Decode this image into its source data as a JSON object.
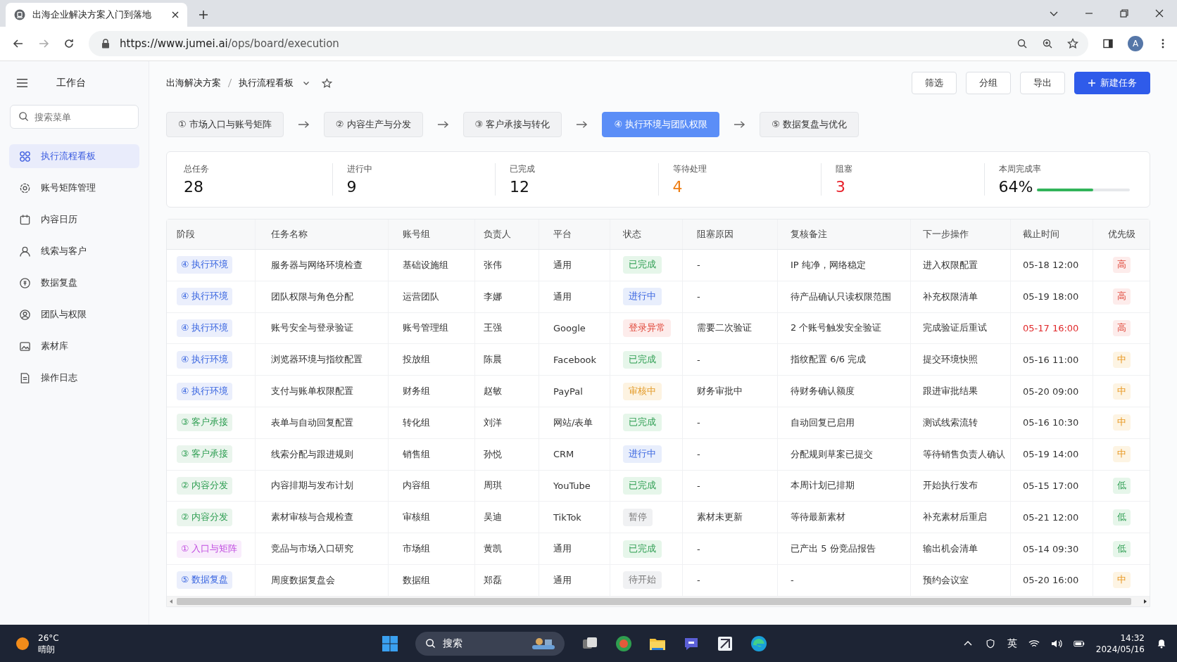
{
  "browser": {
    "tab_title": "出海企业解决方案入门到落地",
    "url_host": "https://www.jumei.ai",
    "url_path": "/ops/board/execution",
    "profile": "A"
  },
  "sidebar": {
    "title": "工作台",
    "search_placeholder": "搜索菜单",
    "items": [
      {
        "label": "执行流程看板",
        "selected": true
      },
      {
        "label": "账号矩阵管理",
        "selected": false
      },
      {
        "label": "内容日历",
        "selected": false
      },
      {
        "label": "线索与客户",
        "selected": false
      },
      {
        "label": "数据复盘",
        "selected": false
      },
      {
        "label": "团队与权限",
        "selected": false
      },
      {
        "label": "素材库",
        "selected": false
      },
      {
        "label": "操作日志",
        "selected": false
      }
    ]
  },
  "breadcrumb": [
    "出海解决方案",
    "执行流程看板"
  ],
  "actions": [
    {
      "label": "筛选",
      "kind": "plain"
    },
    {
      "label": "分组",
      "kind": "plain"
    },
    {
      "label": "导出",
      "kind": "plain"
    },
    {
      "label": "新建任务",
      "kind": "primary"
    }
  ],
  "steps": [
    {
      "number": "①",
      "label": "市场入口与账号矩阵",
      "selected": false
    },
    {
      "number": "②",
      "label": "内容生产与分发",
      "selected": false
    },
    {
      "number": "③",
      "label": "客户承接与转化",
      "selected": false
    },
    {
      "number": "④",
      "label": "执行环境与团队权限",
      "selected": true
    },
    {
      "number": "⑤",
      "label": "数据复盘与优化",
      "selected": false
    }
  ],
  "stats": [
    {
      "label": "总任务",
      "value": "28",
      "kind": "plain"
    },
    {
      "label": "进行中",
      "value": "9",
      "kind": "plain"
    },
    {
      "label": "已完成",
      "value": "12",
      "kind": "plain"
    },
    {
      "label": "等待处理",
      "value": "4",
      "kind": "warning"
    },
    {
      "label": "阻塞",
      "value": "3",
      "kind": "danger"
    },
    {
      "label": "本周完成率",
      "value": "64%",
      "kind": "progress",
      "level": 0.6
    }
  ],
  "table": {
    "columns": [
      "阶段",
      "任务名称",
      "账号组",
      "负责人",
      "平台",
      "状态",
      "阻塞原因",
      "复核备注",
      "下一步操作",
      "截止时间",
      "优先级"
    ],
    "rows": [
      {
        "stage": {
          "label": "④ 执行环境",
          "color": "#3a66e0"
        },
        "task": "服务器与网络环境检查",
        "group": "基础设施组",
        "owner": "张伟",
        "platform": "通用",
        "status": {
          "label": "已完成",
          "kind": "done"
        },
        "reason": "-",
        "note": "IP 纯净，网络稳定",
        "next": "进入权限配置",
        "deadline": "05-18 12:00",
        "overdue": false,
        "priority": {
          "label": "高",
          "kind": "high"
        }
      },
      {
        "stage": {
          "label": "④ 执行环境",
          "color": "#3a66e0"
        },
        "task": "团队权限与角色分配",
        "group": "运营团队",
        "owner": "李娜",
        "platform": "通用",
        "status": {
          "label": "进行中",
          "kind": "progress"
        },
        "reason": "-",
        "note": "待产品确认只读权限范围",
        "next": "补充权限清单",
        "deadline": "05-19 18:00",
        "overdue": false,
        "priority": {
          "label": "高",
          "kind": "high"
        }
      },
      {
        "stage": {
          "label": "④ 执行环境",
          "color": "#3a66e0"
        },
        "task": "账号安全与登录验证",
        "group": "账号管理组",
        "owner": "王强",
        "platform": "Google",
        "status": {
          "label": "登录异常",
          "kind": "error"
        },
        "reason": "需要二次验证",
        "note": "2 个账号触发安全验证",
        "next": "完成验证后重试",
        "deadline": "05-17 16:00",
        "overdue": true,
        "priority": {
          "label": "高",
          "kind": "high"
        }
      },
      {
        "stage": {
          "label": "④ 执行环境",
          "color": "#3a66e0"
        },
        "task": "浏览器环境与指纹配置",
        "group": "投放组",
        "owner": "陈晨",
        "platform": "Facebook",
        "status": {
          "label": "已完成",
          "kind": "done"
        },
        "reason": "-",
        "note": "指纹配置 6/6 完成",
        "next": "提交环境快照",
        "deadline": "05-16 11:00",
        "overdue": false,
        "priority": {
          "label": "中",
          "kind": "mid"
        }
      },
      {
        "stage": {
          "label": "④ 执行环境",
          "color": "#3a66e0"
        },
        "task": "支付与账单权限配置",
        "group": "财务组",
        "owner": "赵敏",
        "platform": "PayPal",
        "status": {
          "label": "审核中",
          "kind": "review"
        },
        "reason": "财务审批中",
        "note": "待财务确认额度",
        "next": "跟进审批结果",
        "deadline": "05-20 09:00",
        "overdue": false,
        "priority": {
          "label": "中",
          "kind": "mid"
        }
      },
      {
        "stage": {
          "label": "③ 客户承接",
          "color": "#2e9e52"
        },
        "task": "表单与自动回复配置",
        "group": "转化组",
        "owner": "刘洋",
        "platform": "网站/表单",
        "status": {
          "label": "已完成",
          "kind": "done"
        },
        "reason": "-",
        "note": "自动回复已启用",
        "next": "测试线索流转",
        "deadline": "05-16 10:30",
        "overdue": false,
        "priority": {
          "label": "中",
          "kind": "mid"
        }
      },
      {
        "stage": {
          "label": "③ 客户承接",
          "color": "#2e9e52"
        },
        "task": "线索分配与跟进规则",
        "group": "销售组",
        "owner": "孙悦",
        "platform": "CRM",
        "status": {
          "label": "进行中",
          "kind": "progress"
        },
        "reason": "-",
        "note": "分配规则草案已提交",
        "next": "等待销售负责人确认",
        "deadline": "05-19 14:00",
        "overdue": false,
        "priority": {
          "label": "中",
          "kind": "mid"
        }
      },
      {
        "stage": {
          "label": "② 内容分发",
          "color": "#2e9e52"
        },
        "task": "内容排期与发布计划",
        "group": "内容组",
        "owner": "周琪",
        "platform": "YouTube",
        "status": {
          "label": "已完成",
          "kind": "done"
        },
        "reason": "-",
        "note": "本周计划已排期",
        "next": "开始执行发布",
        "deadline": "05-15 17:00",
        "overdue": false,
        "priority": {
          "label": "低",
          "kind": "low"
        }
      },
      {
        "stage": {
          "label": "② 内容分发",
          "color": "#2e9e52"
        },
        "task": "素材审核与合规检查",
        "group": "审核组",
        "owner": "吴迪",
        "platform": "TikTok",
        "status": {
          "label": "暂停",
          "kind": "paused"
        },
        "reason": "素材未更新",
        "note": "等待最新素材",
        "next": "补充素材后重启",
        "deadline": "05-21 12:00",
        "overdue": false,
        "priority": {
          "label": "低",
          "kind": "low"
        }
      },
      {
        "stage": {
          "label": "① 入口与矩阵",
          "color": "#c14fe0"
        },
        "task": "竞品与市场入口研究",
        "group": "市场组",
        "owner": "黄凯",
        "platform": "通用",
        "status": {
          "label": "已完成",
          "kind": "done"
        },
        "reason": "-",
        "note": "已产出 5 份竞品报告",
        "next": "输出机会清单",
        "deadline": "05-14 09:30",
        "overdue": false,
        "priority": {
          "label": "低",
          "kind": "low"
        }
      },
      {
        "stage": {
          "label": "⑤ 数据复盘",
          "color": "#3a66e0"
        },
        "task": "周度数据复盘会",
        "group": "数据组",
        "owner": "郑磊",
        "platform": "通用",
        "status": {
          "label": "待开始",
          "kind": "pending"
        },
        "reason": "-",
        "note": "-",
        "next": "预约会议室",
        "deadline": "05-20 16:00",
        "overdue": false,
        "priority": {
          "label": "中",
          "kind": "mid"
        }
      }
    ]
  },
  "taskbar": {
    "temperature": "26°C",
    "weather": "晴朗",
    "search": "搜索",
    "input_method": "英",
    "time": "14:32",
    "date": "2024/05/16"
  }
}
